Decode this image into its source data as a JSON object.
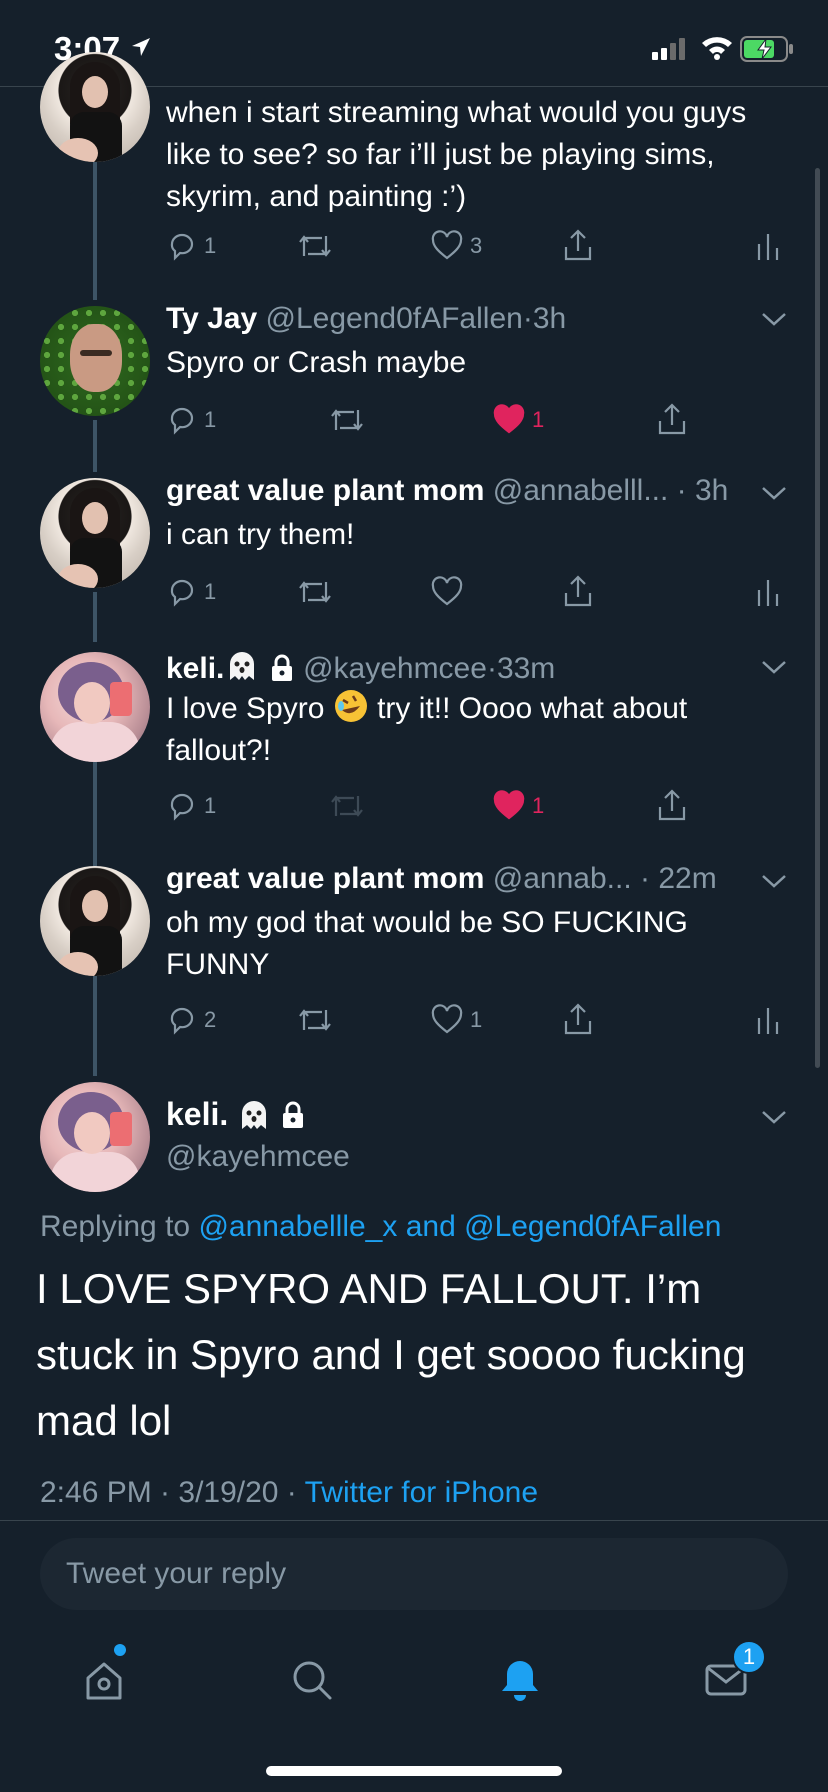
{
  "status_bar": {
    "time": "3:07"
  },
  "tweets": [
    {
      "text": "when i start streaming what would you guys like to see? so far i’ll just be playing sims, skyrim, and painting :’)",
      "replies": "1",
      "retweets": "",
      "likes": "3"
    },
    {
      "name": "Ty Jay",
      "handle": "@Legend0fAFallen",
      "time": "3h",
      "text": "Spyro or Crash maybe",
      "replies": "1",
      "retweets": "",
      "likes": "1"
    },
    {
      "name": "great value plant mom",
      "handle": "@annabelll...",
      "time": "3h",
      "text": "i can try them!",
      "replies": "1",
      "retweets": "",
      "likes": ""
    },
    {
      "name": "keli.",
      "handle": "@kayehmcee",
      "time": "33m",
      "text_before_emoji": "I love Spyro ",
      "text_after_emoji": " try it!! Oooo what about fallout?!",
      "replies": "1",
      "retweets": "",
      "likes": "1"
    },
    {
      "name": "great value plant mom",
      "handle": "@annab...",
      "time": "22m",
      "text": "oh my god that would be SO FUCKING FUNNY",
      "replies": "2",
      "retweets": "",
      "likes": "1"
    }
  ],
  "main_tweet": {
    "name": "keli.",
    "handle": "@kayehmcee",
    "replying_prefix": "Replying to ",
    "reply_user_1": "@annabellle_x",
    "reply_and": " and ",
    "reply_user_2": "@Legend0fAFallen",
    "text": "I LOVE SPYRO AND FALLOUT. I’m stuck in Spyro and I get soooo fucking mad lol",
    "timestamp": "2:46 PM · 3/19/20 · ",
    "source": "Twitter for iPhone"
  },
  "reply_box": {
    "placeholder": "Tweet your reply"
  },
  "tab_bar": {
    "notifications_badge": "1"
  },
  "colors": {
    "background": "#15202b",
    "accent": "#1da1f2",
    "like": "#e0245e",
    "muted": "#8899a6"
  },
  "icons": [
    "location-arrow-icon",
    "signal-icon",
    "wifi-icon",
    "battery-charging-icon",
    "reply-icon",
    "retweet-icon",
    "like-icon",
    "share-icon",
    "analytics-icon",
    "chevron-down-icon",
    "ghost-emoji-icon",
    "lock-icon",
    "rofl-emoji-icon",
    "home-icon",
    "search-icon",
    "notifications-icon",
    "messages-icon"
  ]
}
